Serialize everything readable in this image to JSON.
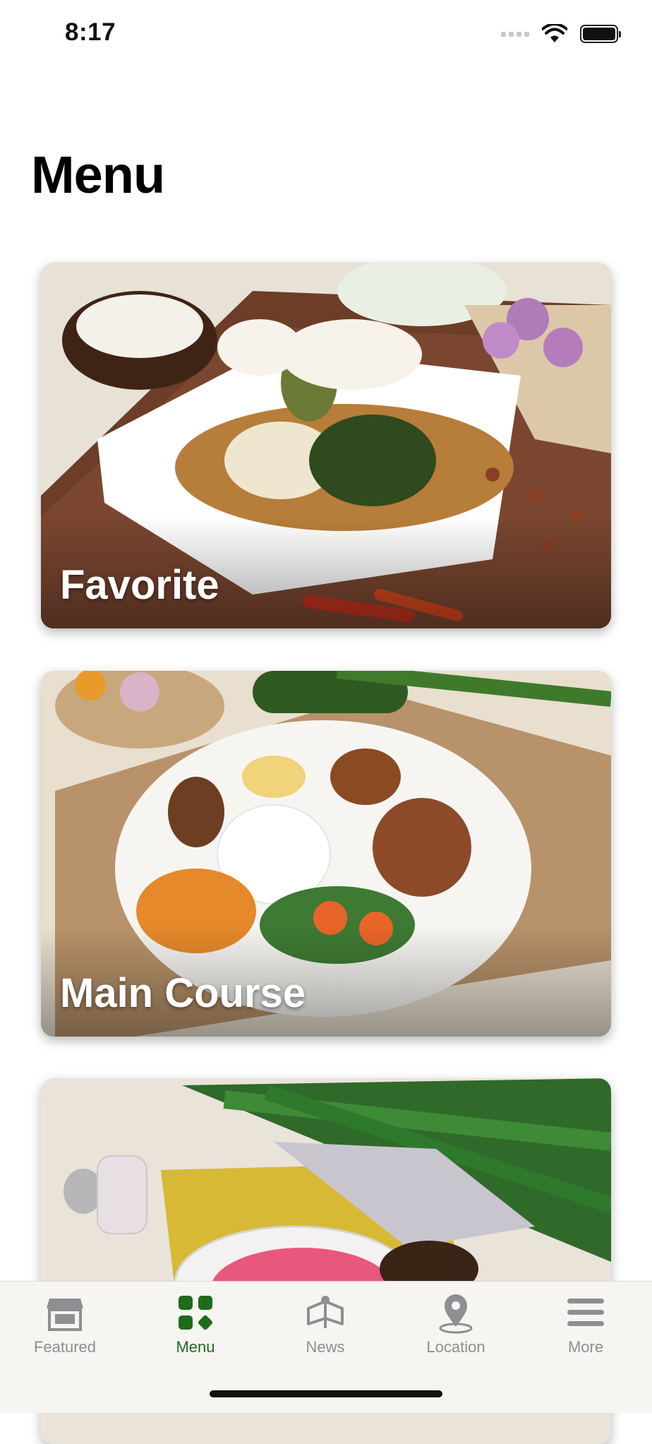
{
  "status": {
    "time": "8:17"
  },
  "page": {
    "title": "Menu"
  },
  "cards": [
    {
      "label": "Favorite"
    },
    {
      "label": "Main Course"
    },
    {
      "label": ""
    }
  ],
  "tabs": [
    {
      "label": "Featured",
      "icon": "storefront-icon",
      "active": false
    },
    {
      "label": "Menu",
      "icon": "grid-icon",
      "active": true
    },
    {
      "label": "News",
      "icon": "news-icon",
      "active": false
    },
    {
      "label": "Location",
      "icon": "location-pin-icon",
      "active": false
    },
    {
      "label": "More",
      "icon": "hamburger-icon",
      "active": false
    }
  ],
  "colors": {
    "accent": "#1f6b1b",
    "inactive": "#8e8e93",
    "tab_bar_bg": "#f6f5f1"
  }
}
